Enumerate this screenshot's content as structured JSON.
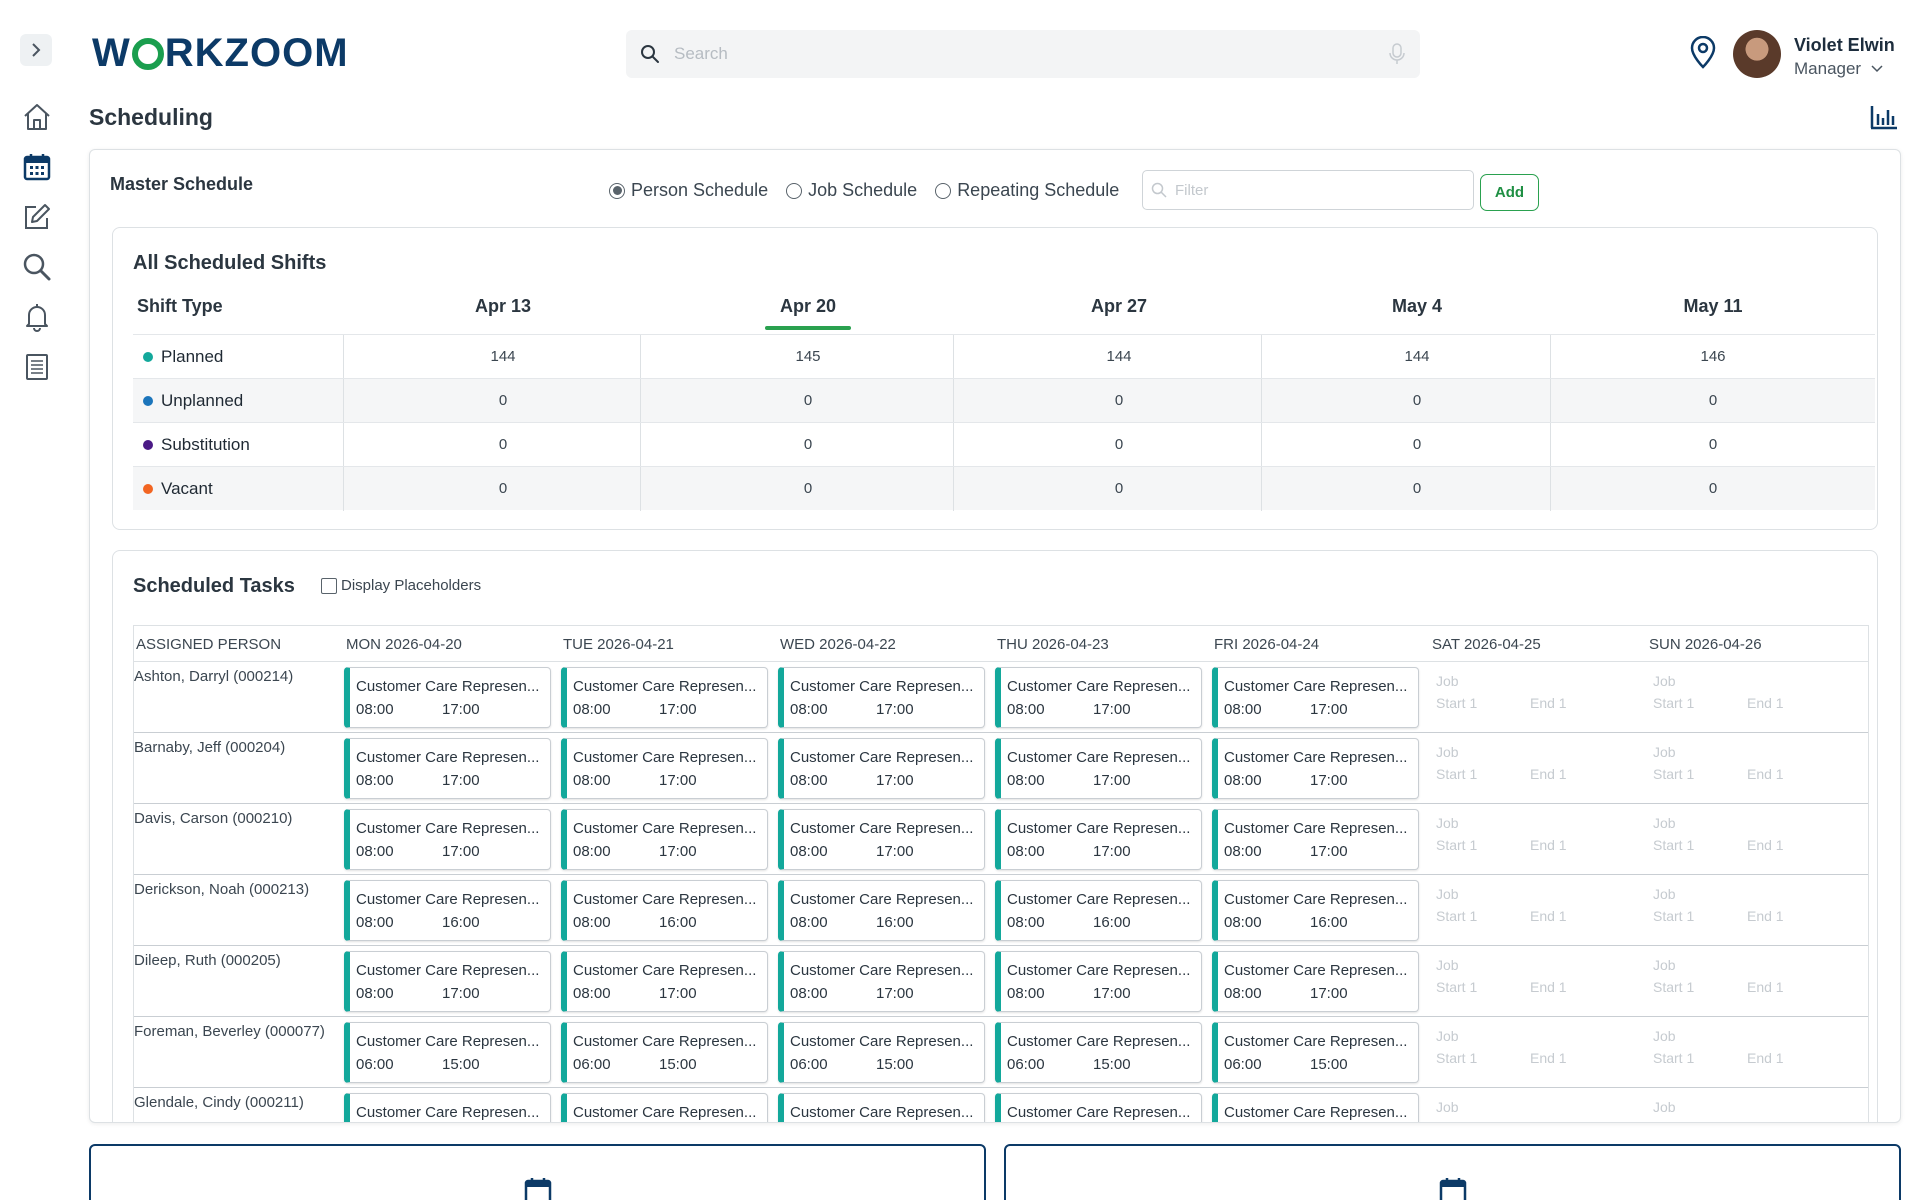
{
  "brand": {
    "logo_text_left": "W",
    "logo_text_right": "RKZOOM",
    "color_primary": "#0c3a67",
    "color_accent": "#1a9e4e"
  },
  "search": {
    "placeholder": "Search"
  },
  "user": {
    "name": "Violet Elwin",
    "role": "Manager"
  },
  "page": {
    "title": "Scheduling"
  },
  "master": {
    "title": "Master Schedule",
    "radios": [
      {
        "label": "Person Schedule",
        "selected": true
      },
      {
        "label": "Job Schedule",
        "selected": false
      },
      {
        "label": "Repeating Schedule",
        "selected": false
      }
    ],
    "filter_placeholder": "Filter",
    "add_label": "Add"
  },
  "shifts": {
    "title": "All Scheduled Shifts",
    "type_header": "Shift Type",
    "columns": [
      "Apr 13",
      "Apr 20",
      "Apr 27",
      "May 4",
      "May 11"
    ],
    "active_column": "Apr 20",
    "rows": [
      {
        "label": "Planned",
        "color": "#13a89b",
        "values": [
          "144",
          "145",
          "144",
          "144",
          "146"
        ]
      },
      {
        "label": "Unplanned",
        "color": "#1b75bb",
        "values": [
          "0",
          "0",
          "0",
          "0",
          "0"
        ]
      },
      {
        "label": "Substitution",
        "color": "#4b1a86",
        "values": [
          "0",
          "0",
          "0",
          "0",
          "0"
        ]
      },
      {
        "label": "Vacant",
        "color": "#f26522",
        "values": [
          "0",
          "0",
          "0",
          "0",
          "0"
        ]
      }
    ]
  },
  "tasks": {
    "title": "Scheduled Tasks",
    "placeholder_checkbox": "Display Placeholders",
    "headers": [
      "ASSIGNED PERSON",
      "MON 2026-04-20",
      "TUE 2026-04-21",
      "WED 2026-04-22",
      "THU 2026-04-23",
      "FRI 2026-04-24",
      "SAT 2026-04-25",
      "SUN 2026-04-26"
    ],
    "job_label": "Customer Care Represen...",
    "empty": {
      "job": "Job",
      "start": "Start 1",
      "end": "End 1"
    },
    "rows": [
      {
        "person": "Ashton, Darryl (000214)",
        "start": "08:00",
        "end": "17:00"
      },
      {
        "person": "Barnaby, Jeff (000204)",
        "start": "08:00",
        "end": "17:00"
      },
      {
        "person": "Davis, Carson (000210)",
        "start": "08:00",
        "end": "17:00"
      },
      {
        "person": "Derickson, Noah (000213)",
        "start": "08:00",
        "end": "16:00"
      },
      {
        "person": "Dileep, Ruth (000205)",
        "start": "08:00",
        "end": "17:00"
      },
      {
        "person": "Foreman, Beverley (000077)",
        "start": "06:00",
        "end": "15:00"
      },
      {
        "person": "Glendale, Cindy (000211)",
        "start": "",
        "end": ""
      }
    ]
  }
}
